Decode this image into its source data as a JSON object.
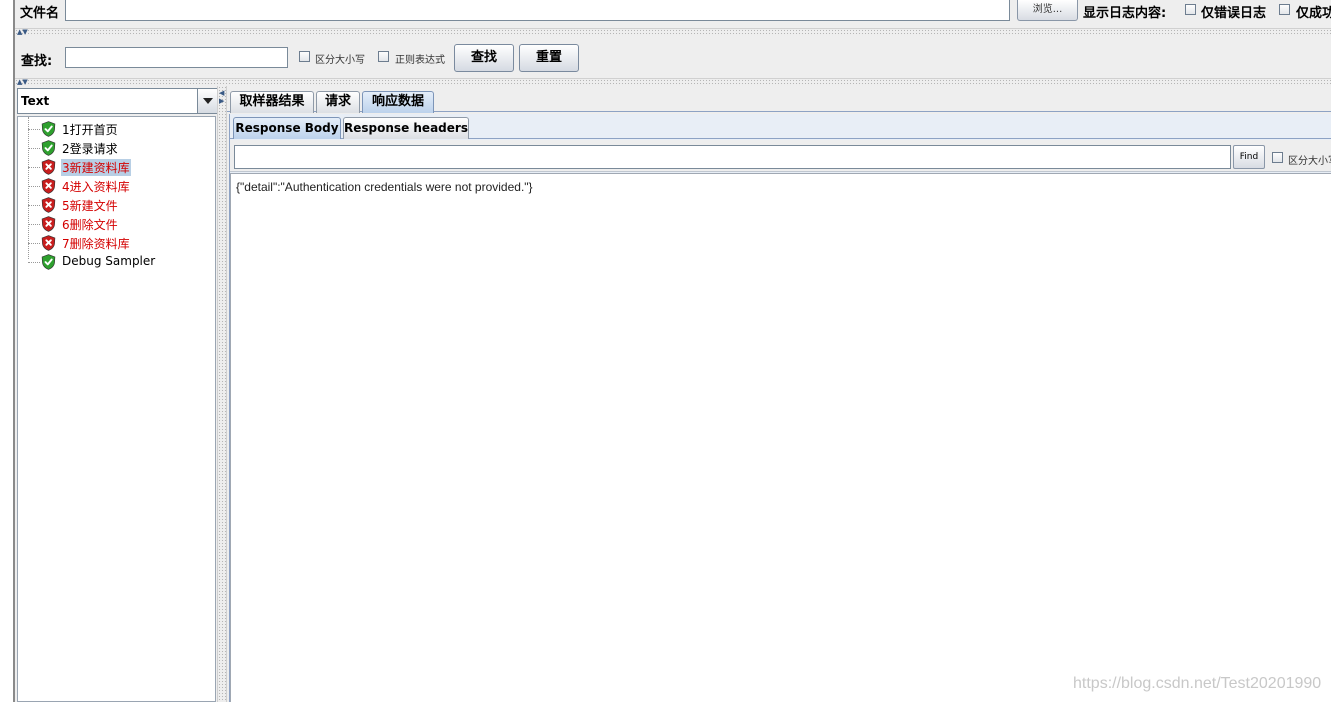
{
  "file_row": {
    "label": "文件名",
    "file_value": "",
    "browse_label": "浏览...",
    "log_label": "显示日志内容:",
    "errors_only_label": "仅错误日志",
    "success_only_label": "仅成功"
  },
  "search_row": {
    "label": "查找:",
    "value": "",
    "case_label": "区分大小写",
    "regex_label": "正则表达式",
    "find_button": "查找",
    "reset_button": "重置"
  },
  "renderer": {
    "selected": "Text"
  },
  "tree": {
    "items": [
      {
        "label": "1打开首页",
        "status": "success"
      },
      {
        "label": "2登录请求",
        "status": "success"
      },
      {
        "label": "3新建资料库",
        "status": "error",
        "selected": true
      },
      {
        "label": "4进入资料库",
        "status": "error"
      },
      {
        "label": "5新建文件",
        "status": "error"
      },
      {
        "label": "6删除文件",
        "status": "error"
      },
      {
        "label": "7删除资料库",
        "status": "error"
      },
      {
        "label": "Debug Sampler",
        "status": "success"
      }
    ]
  },
  "tabs": {
    "sampler_result": "取样器结果",
    "request": "请求",
    "response_data": "响应数据",
    "active": "响应数据"
  },
  "subtabs": {
    "response_body": "Response Body",
    "response_headers": "Response headers",
    "active": "Response Body"
  },
  "response": {
    "search_value": "",
    "find_label": "Find",
    "case_label": "区分大小写",
    "body_text": "{\"detail\":\"Authentication credentials were not provided.\"}"
  },
  "watermark": "https://blog.csdn.net/Test20201990",
  "colors": {
    "error_text": "#d40000",
    "selection": "#b8cfe5",
    "success_icon": "#2ea02e",
    "error_icon": "#c81e1e"
  },
  "icons": {
    "success": "shield-check-icon",
    "error": "shield-x-icon"
  }
}
